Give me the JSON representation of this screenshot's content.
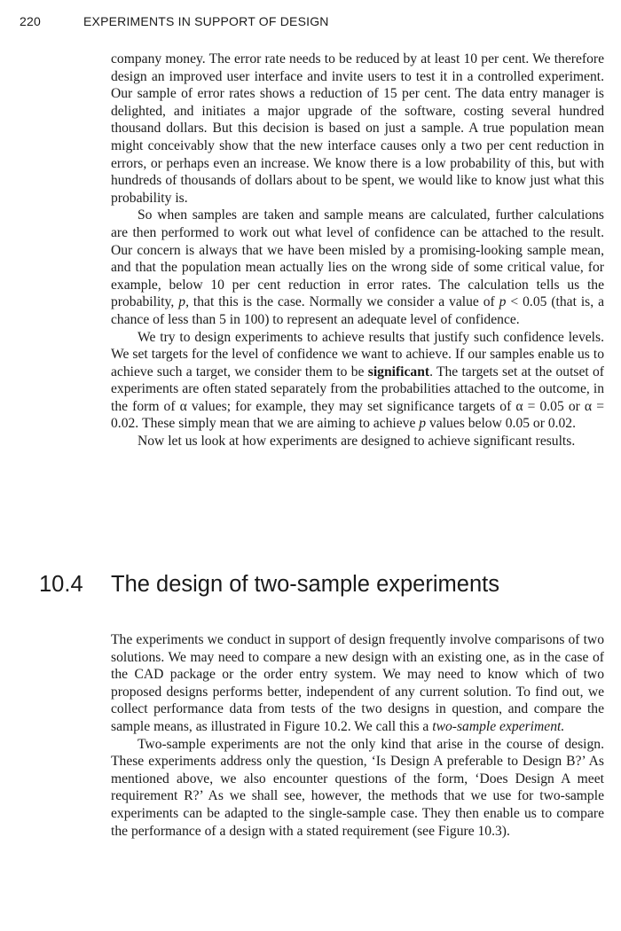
{
  "header": {
    "page_number": "220",
    "running_title": "EXPERIMENTS IN SUPPORT OF DESIGN"
  },
  "body_top": {
    "p1": "company money. The error rate needs to be reduced by at least 10 per cent. We therefore design an improved user interface and invite users to test it in a controlled experiment. Our sample of error rates shows a reduc­tion of 15 per cent. The data entry manager is delighted, and initiates a major upgrade of the software, costing several hundred thousand dollars. But this decision is based on just a sample. A true population mean might conceivably show that the new interface causes only a two per cent reduc­tion in errors, or perhaps even an increase. We know there is a low prob­ability of this, but with hundreds of thousands of dollars about to be spent, we would like to know just what this probability is.",
    "p2_a": "So when samples are taken and sample means are calculated, further calculations are then performed to work out what level of confidence can be attached to the result. Our concern is always that we have been misled by a promising-looking sample mean, and that the population mean actu­ally lies on the wrong side of some critical value, for example, below 10 per cent reduction in error rates. The calculation tells us the probability,",
    "p2_var1": "p,",
    "p2_b": "that this is the case. Normally we consider a value of",
    "p2_var2": "p",
    "p2_c": "< 0.05 (that is, a chance of less than 5 in 100) to represent an adequate level of confidence.",
    "p3_a": "We try to design experiments to achieve results that justify such con­fidence levels. We set targets for the level of confidence we want to achieve. If our samples enable us to achieve such a target, we consider them to be",
    "p3_term": "significant",
    "p3_b": ". The targets set at the outset of experiments are often stated separately from the probabilities attached to the outcome, in the form of α values; for example, they may set significance targets of α = 0.05 or α = 0.02. These simply mean that we are aiming to achieve",
    "p3_var": "p",
    "p3_c": "val­ues below 0.05 or 0.02.",
    "p4": "Now let us look at how experiments are designed to achieve signifi­cant results."
  },
  "section": {
    "number": "10.4",
    "title": "The design of two-sample experiments"
  },
  "body_bottom": {
    "p1_a": "The experiments we conduct in support of design frequently involve com­parisons of two solutions. We may need to compare a new design with an existing one, as in the case of the CAD package or the order entry system. We may need to know which of two proposed designs performs better, independent of any current solution. To find out, we collect performance data from tests of the two designs in question, and compare the sample means, as illustrated in Figure 10.2. We call this a",
    "p1_term": "two-sample experiment.",
    "p2": "Two-sample experiments are not the only kind that arise in the course of design. These experiments address only the question, ‘Is Design A preferable to Design B?’ As mentioned above, we also encounter ques­tions of the form, ‘Does Design A meet requirement R?’ As we shall see, however, the methods that we use for two-sample experiments can be adapted to the single-sample case. They then enable us to compare the performance of a design with a stated requirement (see Figure 10.3)."
  }
}
